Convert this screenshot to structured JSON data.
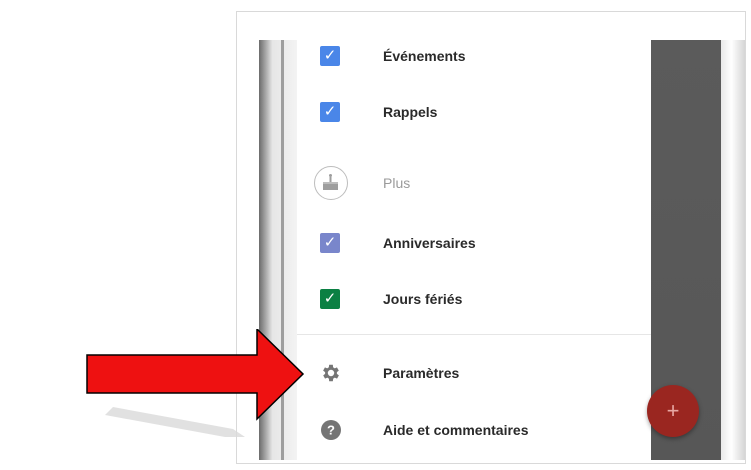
{
  "menu": {
    "items": [
      {
        "label": "Événements",
        "icon": "checkbox-checked",
        "color": "#4a86e8"
      },
      {
        "label": "Rappels",
        "icon": "checkbox-checked",
        "color": "#4a86e8"
      },
      {
        "label": "Plus",
        "icon": "birthday-cake-icon"
      },
      {
        "label": "Anniversaires",
        "icon": "checkbox-checked",
        "color": "#7986cb"
      },
      {
        "label": "Jours fériés",
        "icon": "checkbox-checked",
        "color": "#0b8043"
      },
      {
        "label": "Paramètres",
        "icon": "gear-icon"
      },
      {
        "label": "Aide et commentaires",
        "icon": "help-icon"
      }
    ]
  },
  "fab": {
    "label": "+"
  },
  "colors": {
    "arrow": "#ee1111",
    "scrim": "#5a5a5a",
    "fab": "#9a2620"
  }
}
